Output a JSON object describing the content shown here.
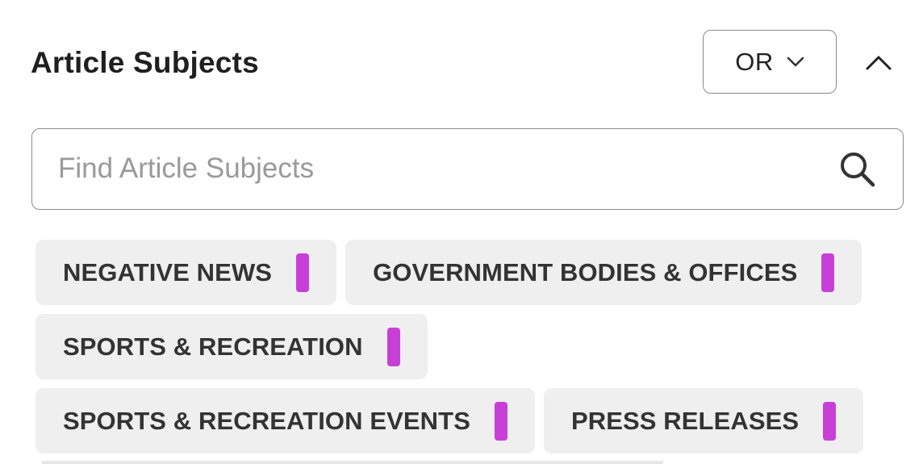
{
  "filter": {
    "title": "Article Subjects",
    "operator": {
      "value": "OR",
      "icon": "chevron-down-icon"
    },
    "collapse_icon": "chevron-up-icon",
    "search": {
      "placeholder": "Find Article Subjects",
      "value": "",
      "icon": "search-icon"
    },
    "chips": [
      {
        "label": "NEGATIVE NEWS"
      },
      {
        "label": "GOVERNMENT BODIES & OFFICES"
      },
      {
        "label": "SPORTS & RECREATION"
      },
      {
        "label": "SPORTS & RECREATION EVENTS"
      },
      {
        "label": "PRESS RELEASES"
      }
    ]
  },
  "colors": {
    "chip_indicator": "#c83fd8",
    "chip_background": "#efefef",
    "border": "#8a8a8a"
  }
}
